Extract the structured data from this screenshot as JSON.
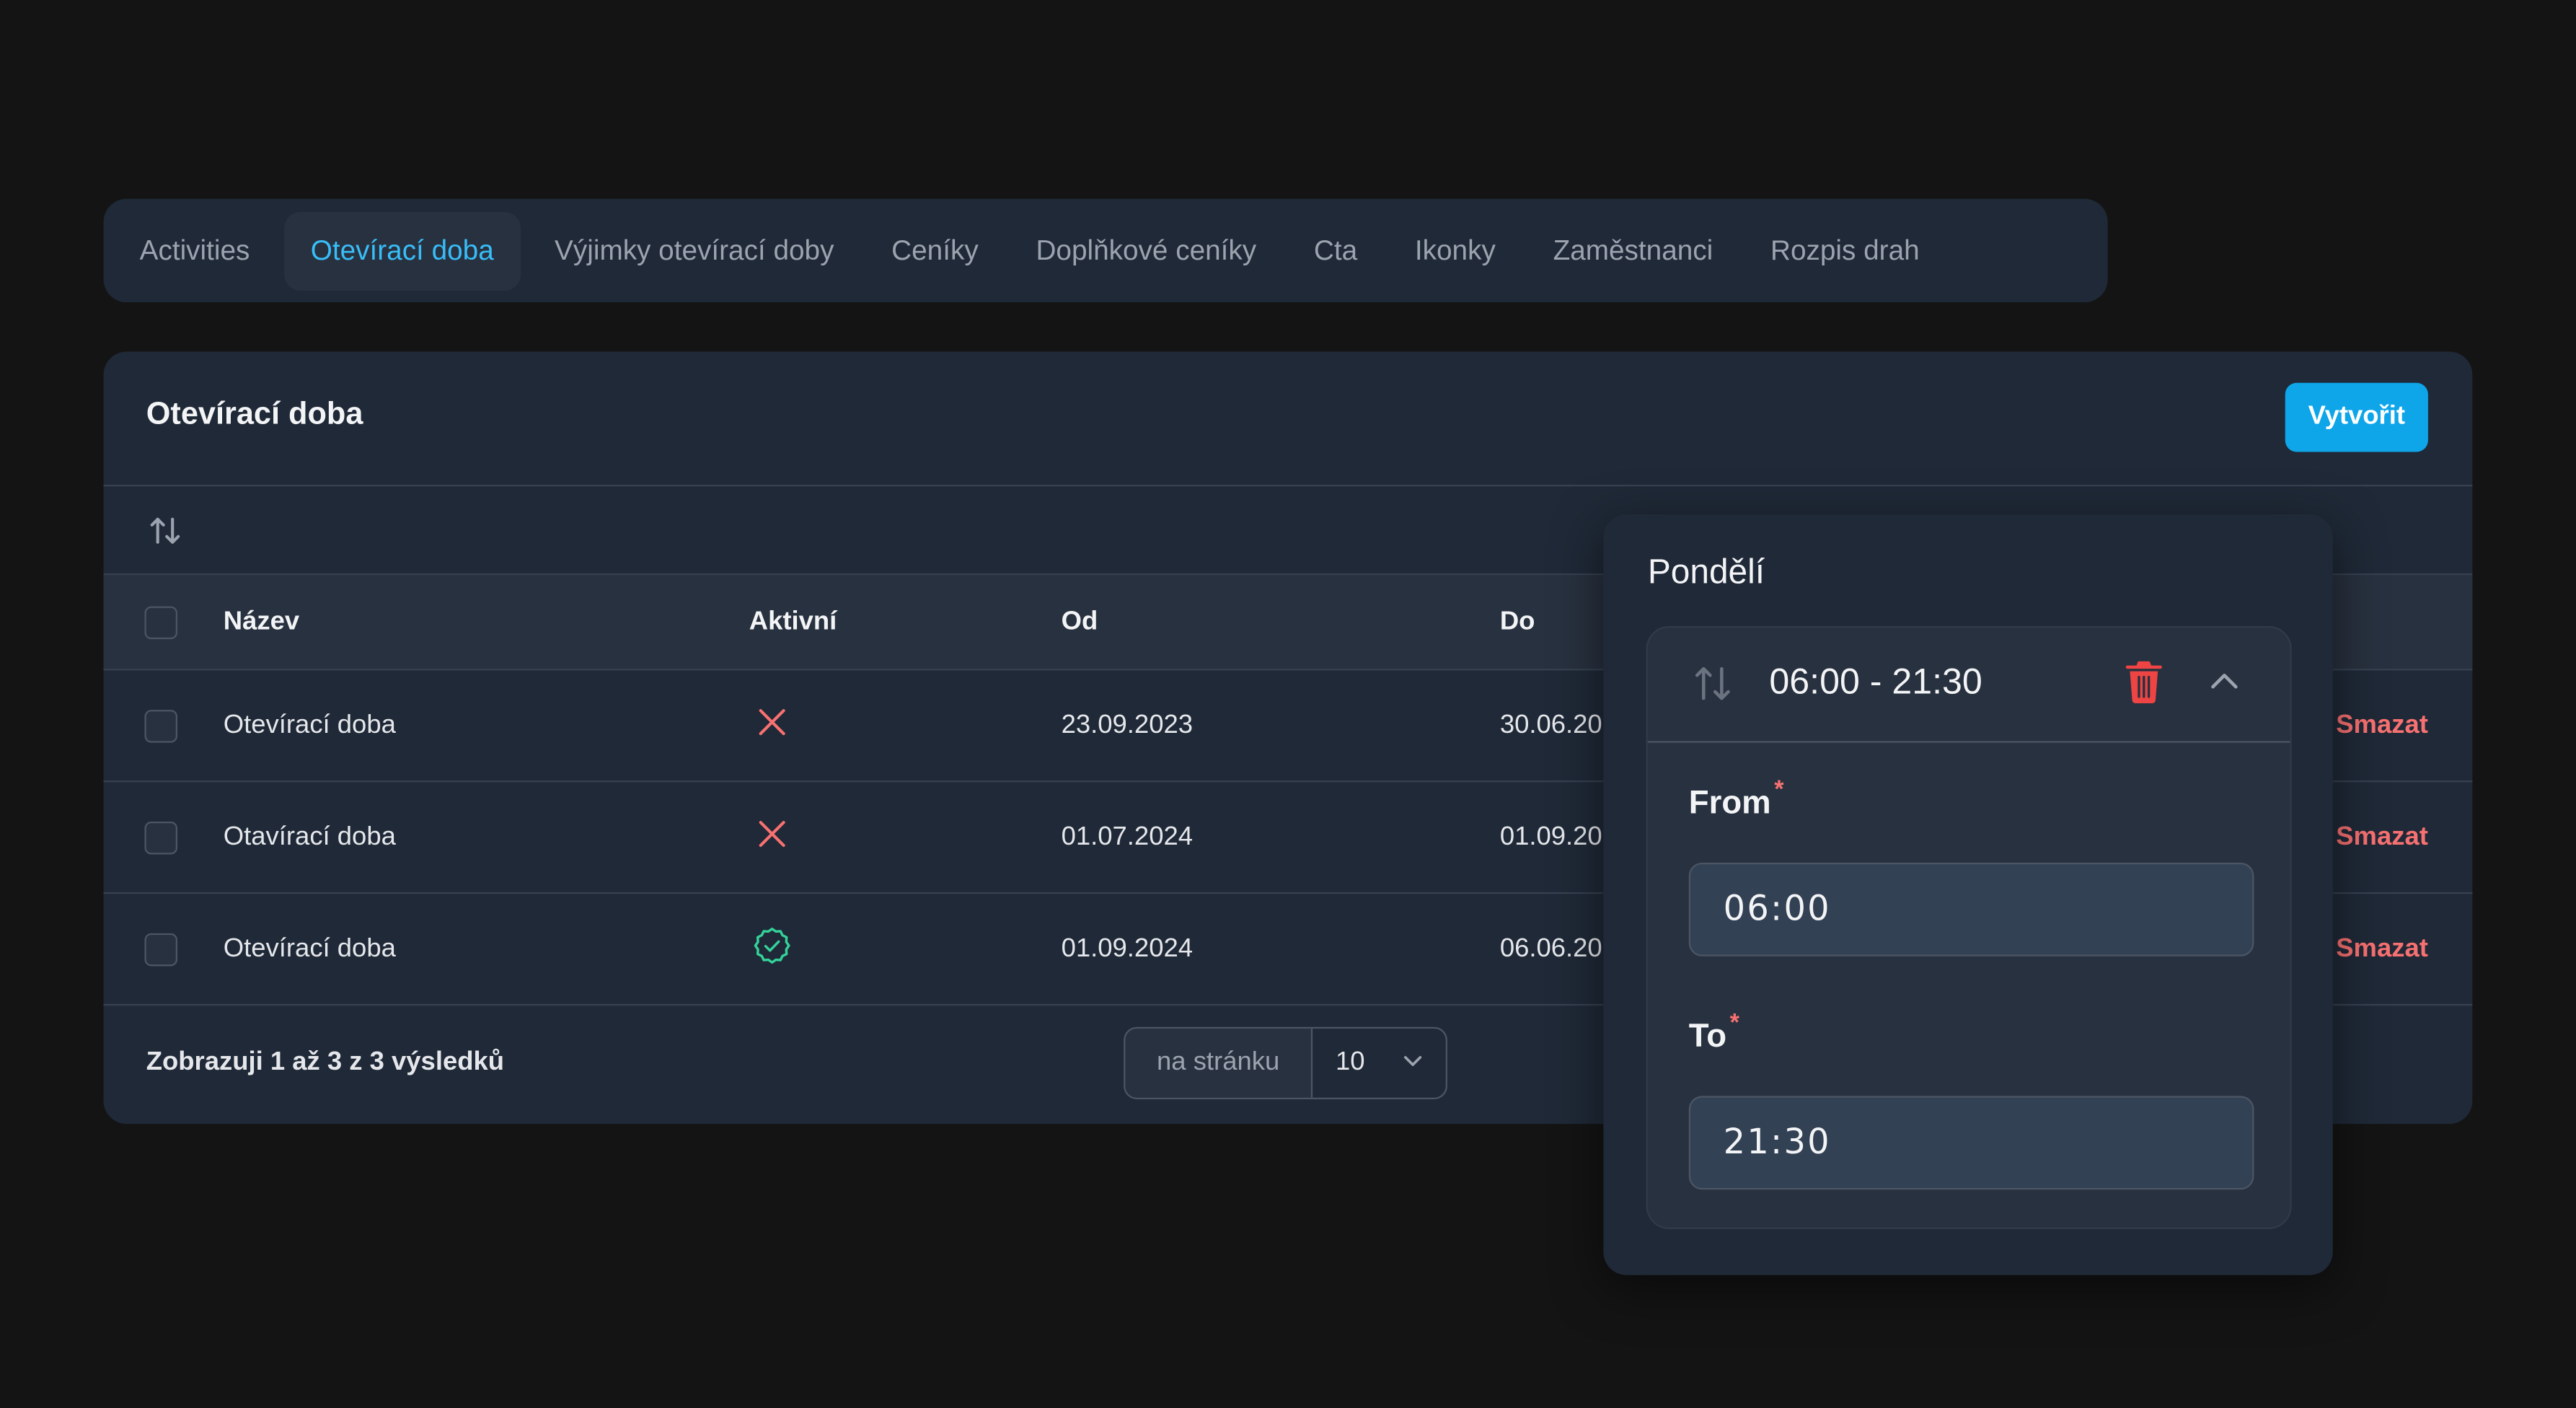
{
  "tabs": [
    {
      "label": "Activities"
    },
    {
      "label": "Otevírací doba"
    },
    {
      "label": "Výjimky otevírací doby"
    },
    {
      "label": "Ceníky"
    },
    {
      "label": "Doplňkové ceníky"
    },
    {
      "label": "Cta"
    },
    {
      "label": "Ikonky"
    },
    {
      "label": "Zaměstnanci"
    },
    {
      "label": "Rozpis drah"
    }
  ],
  "active_tab": "Otevírací doba",
  "card": {
    "title": "Otevírací doba",
    "create_label": "Vytvořit"
  },
  "table": {
    "headers": {
      "name": "Název",
      "active": "Aktivní",
      "from": "Od",
      "to": "Do"
    },
    "rows": [
      {
        "name": "Otevírací doba",
        "active": false,
        "from": "23.09.2023",
        "to": "30.06.20",
        "delete": "Smazat"
      },
      {
        "name": "Otavírací doba",
        "active": false,
        "from": "01.07.2024",
        "to": "01.09.20",
        "delete": "Smazat"
      },
      {
        "name": "Otevírací doba",
        "active": true,
        "from": "01.09.2024",
        "to": "06.06.20",
        "delete": "Smazat"
      }
    ]
  },
  "footer": {
    "summary": "Zobrazuji 1 až 3 z 3 výsledků",
    "per_page_label": "na stránku",
    "per_page_value": "10"
  },
  "popover": {
    "title": "Pondělí",
    "range": "06:00 - 21:30",
    "from_label": "From",
    "from_value": "06:00",
    "to_label": "To",
    "to_value": "21:30",
    "required_mark": "*"
  },
  "colors": {
    "accent": "#38bdf8",
    "primary_button": "#0ea5e9",
    "danger": "#f87171",
    "success": "#34d399"
  },
  "icons": {
    "sort": "sort-arrows-icon",
    "inactive": "x-icon",
    "active": "check-badge-icon",
    "trash": "trash-icon",
    "chevron_up": "chevron-up-icon",
    "chevron_down": "chevron-down-icon"
  }
}
